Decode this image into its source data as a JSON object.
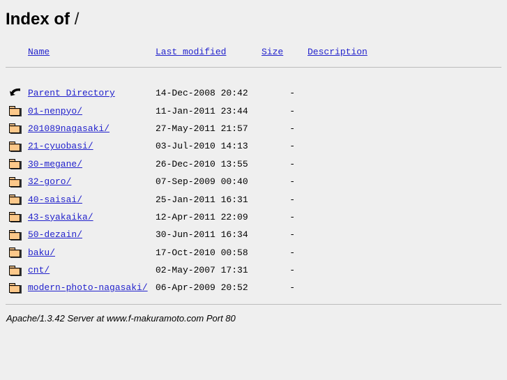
{
  "page": {
    "title_prefix": "Index of",
    "title_path": "/",
    "background_color": "#efefef",
    "link_color": "#2222cc",
    "rule_color": "#bcbcbc"
  },
  "columns": {
    "name": "Name",
    "last_modified": "Last modified",
    "size": "Size",
    "description": "Description"
  },
  "entries": [
    {
      "icon": "back-icon",
      "name": "Parent Directory",
      "last_modified": "14-Dec-2008 20:42",
      "size": "-",
      "description": ""
    },
    {
      "icon": "folder-icon",
      "name": "01-nenpyo/",
      "last_modified": "11-Jan-2011 23:44",
      "size": "-",
      "description": ""
    },
    {
      "icon": "folder-icon",
      "name": "201089nagasaki/",
      "last_modified": "27-May-2011 21:57",
      "size": "-",
      "description": ""
    },
    {
      "icon": "folder-icon",
      "name": "21-cyuobasi/",
      "last_modified": "03-Jul-2010 14:13",
      "size": "-",
      "description": ""
    },
    {
      "icon": "folder-icon",
      "name": "30-megane/",
      "last_modified": "26-Dec-2010 13:55",
      "size": "-",
      "description": ""
    },
    {
      "icon": "folder-icon",
      "name": "32-goro/",
      "last_modified": "07-Sep-2009 00:40",
      "size": "-",
      "description": ""
    },
    {
      "icon": "folder-icon",
      "name": "40-saisai/",
      "last_modified": "25-Jan-2011 16:31",
      "size": "-",
      "description": ""
    },
    {
      "icon": "folder-icon",
      "name": "43-syakaika/",
      "last_modified": "12-Apr-2011 22:09",
      "size": "-",
      "description": ""
    },
    {
      "icon": "folder-icon",
      "name": "50-dezain/",
      "last_modified": "30-Jun-2011 16:34",
      "size": "-",
      "description": ""
    },
    {
      "icon": "folder-icon",
      "name": "baku/",
      "last_modified": "17-Oct-2010 00:58",
      "size": "-",
      "description": ""
    },
    {
      "icon": "folder-icon",
      "name": "cnt/",
      "last_modified": "02-May-2007 17:31",
      "size": "-",
      "description": ""
    },
    {
      "icon": "folder-icon",
      "name": "modern-photo-nagasaki/",
      "last_modified": "06-Apr-2009 20:52",
      "size": "-",
      "description": ""
    }
  ],
  "footer": {
    "address": "Apache/1.3.42 Server at www.f-makuramoto.com Port 80"
  }
}
